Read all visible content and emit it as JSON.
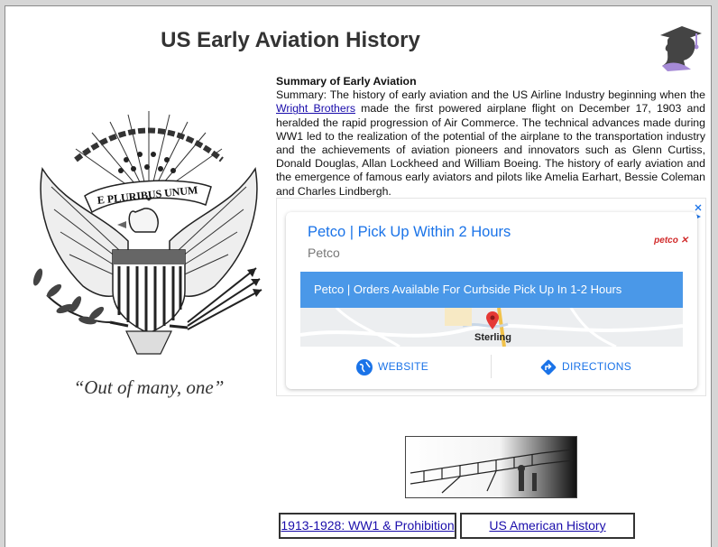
{
  "page": {
    "title": "US Early Aviation History"
  },
  "seal": {
    "banner_text": "E PLURIBUS UNUM",
    "motto": "“Out of many, one”"
  },
  "summary": {
    "heading": "Summary of Early Aviation",
    "text_before_link": "Summary: The history of early aviation and the US Airline Industry beginning when the ",
    "link_text": "Wright Brothers",
    "text_after_link": " made the first powered airplane flight on December 17, 1903 and heralded the rapid progression of Air Commerce. The technical advances made during WW1 led to the realization of the potential of the airplane to the transportation industry and the achievements of aviation pioneers and innovators such as Glenn Curtiss, Donald Douglas, Allan Lockheed and William Boeing. The history of early aviation and the emergence of famous early aviators and pilots like Amelia Earhart, Bessie Coleman and  Charles Lindbergh."
  },
  "ad": {
    "headline": "Petco | Pick Up Within 2 Hours",
    "advertiser": "Petco",
    "logo": "petco",
    "banner": "Petco | Orders Available For Curbside Pick Up In 1-2 Hours",
    "map_label": "Sterling",
    "website_label": "WEBSITE",
    "directions_label": "DIRECTIONS",
    "accent_color": "#1a73e8",
    "banner_color": "#4a98e8"
  },
  "nav": {
    "prev_label": "1913-1928: WW1 & Prohibition",
    "next_label": "US American History"
  }
}
